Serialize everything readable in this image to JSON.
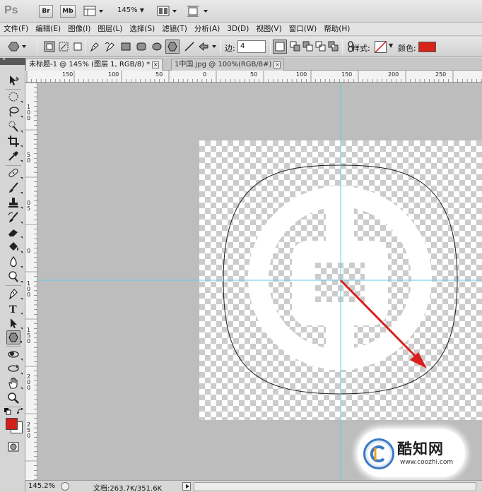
{
  "app": {
    "logo": "Ps",
    "bridge_btn": "Br",
    "minibridge_btn": "Mb",
    "zoom_level": "145%"
  },
  "menu": [
    "文件(F)",
    "编辑(E)",
    "图像(I)",
    "图层(L)",
    "选择(S)",
    "滤镜(T)",
    "分析(A)",
    "3D(D)",
    "视图(V)",
    "窗口(W)",
    "帮助(H)"
  ],
  "options": {
    "sides_label": "边:",
    "sides_value": "4",
    "style_label": "样式:",
    "color_label": "颜色:",
    "color_value": "#d62418"
  },
  "tabs": [
    {
      "label": "未标题-1 @ 145% (图层 1, RGB/8) *",
      "close": "×"
    },
    {
      "label": "1中国.jpg @ 100%(RGB/8#)",
      "close": "×"
    }
  ],
  "rulers": {
    "top": [
      "150",
      "100",
      "50",
      "0",
      "50",
      "100",
      "150",
      "200",
      "250"
    ],
    "left": [
      "1",
      "0",
      "0",
      "5",
      "0",
      "0",
      "5",
      "0",
      "1",
      "0",
      "0",
      "1",
      "5",
      "0",
      "2",
      "0",
      "0",
      "2",
      "5",
      "0"
    ]
  },
  "toolbar": {
    "foreground_color": "#d21f1b",
    "background_color": "#ffffff"
  },
  "watermark": {
    "name": "酷知网",
    "url": "www.coozhi.com"
  },
  "status": {
    "zoom": "145.2%",
    "doc_info": "文档:263.7K/351.6K"
  },
  "colors": {
    "guide": "#5ad0e6",
    "arrow": "#d91e1e",
    "logo_fill": "#ffffff",
    "path_stroke": "#1a1a1a"
  }
}
